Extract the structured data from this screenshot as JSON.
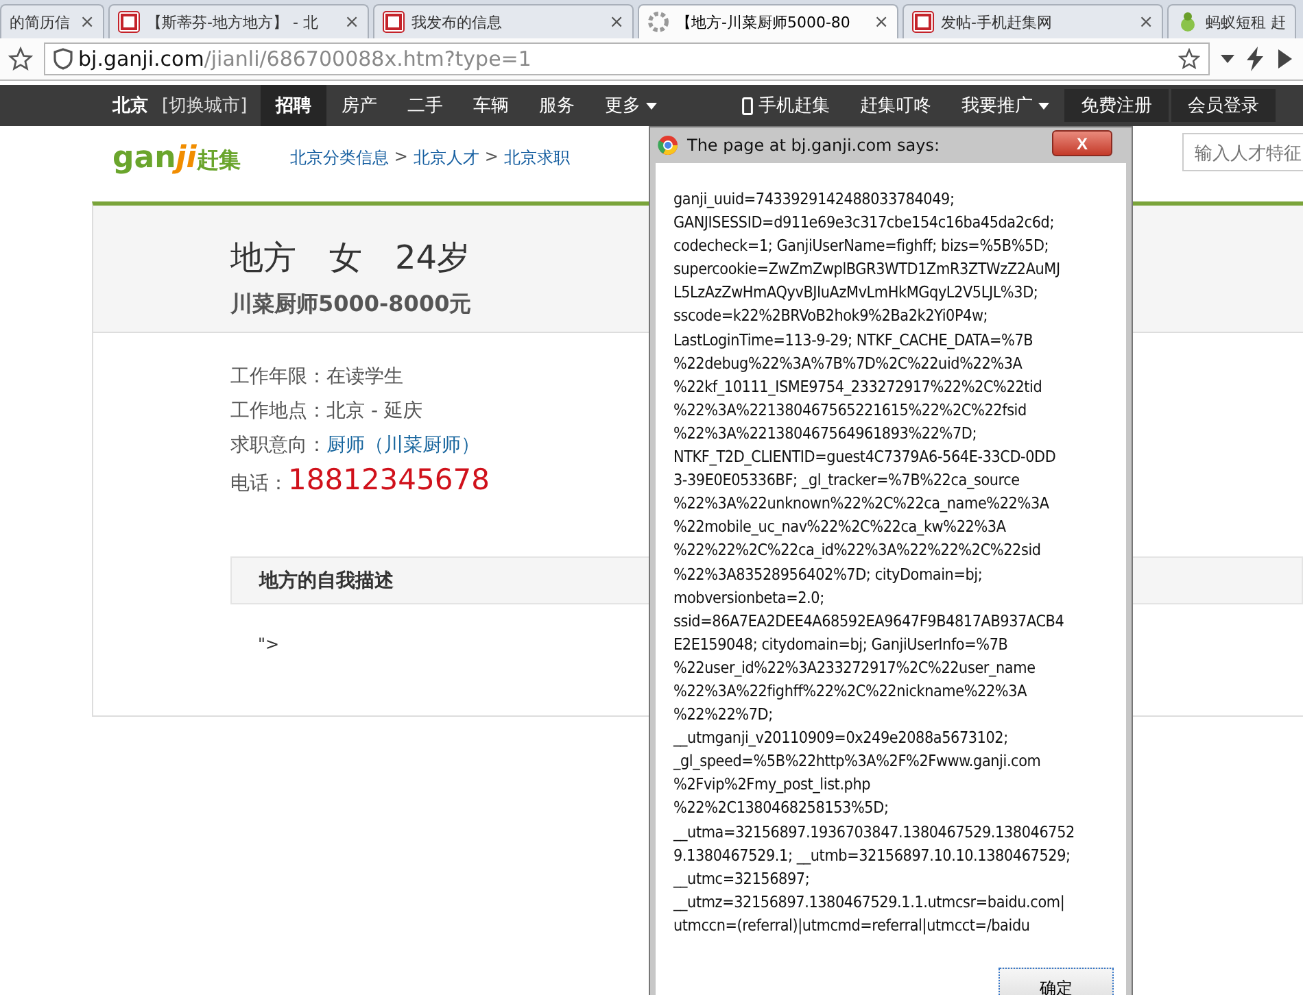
{
  "browser": {
    "tabs": [
      {
        "title": "的简历信",
        "kind": "none",
        "selected": false,
        "close": "×"
      },
      {
        "title": "【斯蒂芬-地方地方】 - 北",
        "kind": "site",
        "selected": false,
        "close": "×"
      },
      {
        "title": "我发布的信息",
        "kind": "site",
        "selected": false,
        "close": "×"
      },
      {
        "title": "【地方-川菜厨师5000-80",
        "kind": "loading",
        "selected": true,
        "close": "×"
      },
      {
        "title": "发帖-手机赶集网",
        "kind": "site",
        "selected": false,
        "close": "×"
      },
      {
        "title": "蚂蚁短租 赶",
        "kind": "ant",
        "selected": false
      }
    ],
    "url_host": "bj.ganji.com",
    "url_path": "/jianli/686700088x.htm?type=1"
  },
  "nav": {
    "city": "北京",
    "switch_city": "[切换城市]",
    "items": [
      {
        "label": "招聘",
        "selected": true
      },
      {
        "label": "房产",
        "selected": false
      },
      {
        "label": "二手",
        "selected": false
      },
      {
        "label": "车辆",
        "selected": false
      },
      {
        "label": "服务",
        "selected": false
      },
      {
        "label": "更多",
        "selected": false,
        "dropdown": true
      }
    ],
    "right": [
      {
        "label": "手机赶集",
        "kind": "phone"
      },
      {
        "label": "赶集叮咚",
        "kind": "plain"
      },
      {
        "label": "我要推广",
        "kind": "dropdown"
      }
    ],
    "register": "免费注册",
    "login": "会员登录"
  },
  "header": {
    "logo_latin": "gan",
    "logo_ji": "ji",
    "logo_cn": "赶集",
    "breadcrumb": [
      {
        "label": "北京分类信息"
      },
      {
        "separator": ">",
        "label": "北京人才"
      },
      {
        "separator": ">",
        "label": "北京求职"
      }
    ],
    "search_placeholder": "输入人才特征"
  },
  "resume": {
    "name": "地方",
    "gender": "女",
    "age": "24岁",
    "title": "川菜厨师5000-8000元",
    "fields": [
      {
        "label": "工作年限：",
        "value": "在读学生",
        "kind": "text"
      },
      {
        "label": "工作地点：",
        "value": "北京 - 延庆",
        "kind": "text"
      },
      {
        "label": "求职意向：",
        "value": "厨师（川菜厨师）",
        "kind": "link"
      },
      {
        "label": "电话：",
        "value": "18812345678",
        "kind": "phone"
      }
    ],
    "section_title": "地方的自我描述",
    "section_body": "\">"
  },
  "dialog": {
    "title": "The page at bj.ganji.com says:",
    "lines": [
      "ganji_uuid=7433929142488033784049;",
      "GANJISESSID=d911e69e3c317cbe154c16ba45da2c6d;",
      "codecheck=1; GanjiUserName=fighff; bizs=%5B%5D;",
      "supercookie=ZwZmZwplBGR3WTD1ZmR3ZTWzZ2AuMJ",
      "L5LzAzZwHmAQyvBJIuAzMvLmHkMGqyL2V5LJL%3D;",
      "sscode=k22%2BRVoB2hok9%2Ba2k2Yi0P4w;",
      "LastLoginTime=113-9-29; NTKF_CACHE_DATA=%7B",
      "%22debug%22%3A%7B%7D%2C%22uid%22%3A",
      "%22kf_10111_ISME9754_233272917%22%2C%22tid",
      "%22%3A%221380467565221615%22%2C%22fsid",
      "%22%3A%221380467564961893%22%7D;",
      "NTKF_T2D_CLIENTID=guest4C7379A6-564E-33CD-0DD",
      "3-39E0E05336BF; _gl_tracker=%7B%22ca_source",
      "%22%3A%22unknown%22%2C%22ca_name%22%3A",
      "%22mobile_uc_nav%22%2C%22ca_kw%22%3A",
      "%22%22%2C%22ca_id%22%3A%22%22%2C%22sid",
      "%22%3A83528956402%7D; cityDomain=bj;",
      "mobversionbeta=2.0;",
      "ssid=86A7EA2DEE4A68592EA9647F9B4817AB937ACB4",
      "E2E159048; citydomain=bj; GanjiUserInfo=%7B",
      "%22user_id%22%3A233272917%2C%22user_name",
      "%22%3A%22fighff%22%2C%22nickname%22%3A",
      "%22%22%7D;",
      "__utmganji_v20110909=0x249e2088a5673102;",
      "_gl_speed=%5B%22http%3A%2F%2Fwww.ganji.com",
      "%2Fvip%2Fmy_post_list.php",
      "%22%2C1380468258153%5D;",
      "__utma=32156897.1936703847.1380467529.138046752",
      "9.1380467529.1; __utmb=32156897.10.10.1380467529;",
      "__utmc=32156897;",
      "__utmz=32156897.1380467529.1.1.utmcsr=baidu.com|",
      "utmccn=(referral)|utmcmd=referral|utmcct=/baidu"
    ],
    "close": "X",
    "ok": "确定"
  }
}
